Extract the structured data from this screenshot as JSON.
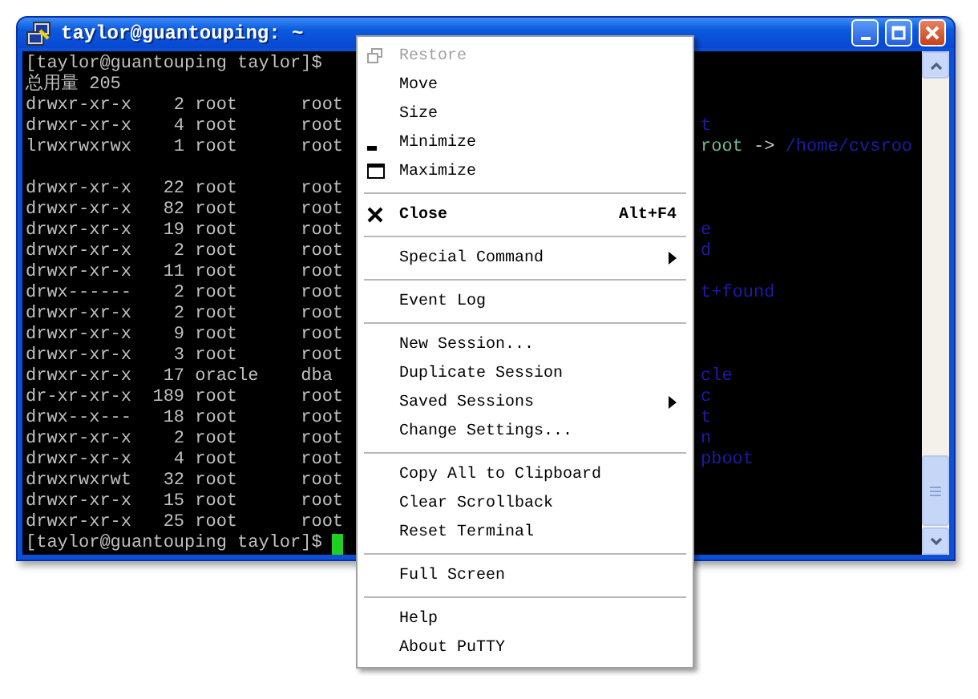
{
  "window": {
    "title": "taylor@guantouping: ~"
  },
  "terminal": {
    "lines": [
      {
        "kind": "text",
        "left": "[taylor@guantouping taylor]$"
      },
      {
        "kind": "text",
        "left": "总用量 205"
      },
      {
        "kind": "text",
        "left": "drwxr-xr-x    2 root      root"
      },
      {
        "kind": "text",
        "left": "drwxr-xr-x    4 root      root",
        "right": [
          {
            "text": "t",
            "color": "#1c1ca8"
          }
        ]
      },
      {
        "kind": "text",
        "left": "lrwxrwxrwx    1 root      root",
        "right": [
          {
            "text": "root",
            "color": "#70b890"
          },
          {
            "text": " -> ",
            "color": "#d0d0d0"
          },
          {
            "text": "/home/cvsroo",
            "color": "#1c1ca8"
          }
        ]
      },
      {
        "kind": "blank"
      },
      {
        "kind": "text",
        "left": "drwxr-xr-x   22 root      root"
      },
      {
        "kind": "text",
        "left": "drwxr-xr-x   82 root      root"
      },
      {
        "kind": "text",
        "left": "drwxr-xr-x   19 root      root",
        "right": [
          {
            "text": "e",
            "color": "#1c1ca8"
          }
        ]
      },
      {
        "kind": "text",
        "left": "drwxr-xr-x    2 root      root",
        "right": [
          {
            "text": "d",
            "color": "#1c1ca8"
          }
        ]
      },
      {
        "kind": "text",
        "left": "drwxr-xr-x   11 root      root"
      },
      {
        "kind": "text",
        "left": "drwx------    2 root      root",
        "right": [
          {
            "text": "t+found",
            "color": "#1c1ca8"
          }
        ]
      },
      {
        "kind": "text",
        "left": "drwxr-xr-x    2 root      root"
      },
      {
        "kind": "text",
        "left": "drwxr-xr-x    9 root      root"
      },
      {
        "kind": "text",
        "left": "drwxr-xr-x    3 root      root"
      },
      {
        "kind": "text",
        "left": "drwxr-xr-x   17 oracle    dba",
        "right": [
          {
            "text": "cle",
            "color": "#1c1ca8"
          }
        ]
      },
      {
        "kind": "text",
        "left": "dr-xr-xr-x  189 root      root",
        "right": [
          {
            "text": "c",
            "color": "#1c1ca8"
          }
        ]
      },
      {
        "kind": "text",
        "left": "drwx--x---   18 root      root",
        "right": [
          {
            "text": "t",
            "color": "#1c1ca8"
          }
        ]
      },
      {
        "kind": "text",
        "left": "drwxr-xr-x    2 root      root",
        "right": [
          {
            "text": "n",
            "color": "#1c1ca8"
          }
        ]
      },
      {
        "kind": "text",
        "left": "drwxr-xr-x    4 root      root",
        "right": [
          {
            "text": "pboot",
            "color": "#1c1ca8"
          }
        ]
      },
      {
        "kind": "text",
        "left": "drwxrwxrwt   32 root      root"
      },
      {
        "kind": "text",
        "left": "drwxr-xr-x   15 root      root"
      },
      {
        "kind": "text",
        "left": "drwxr-xr-x   25 root      root"
      },
      {
        "kind": "input",
        "left": "[taylor@guantouping taylor]$ "
      }
    ]
  },
  "menu": {
    "items": [
      {
        "kind": "restore",
        "label": "Restore",
        "disabled": true
      },
      {
        "kind": "plain",
        "label": "Move",
        "disabled": false
      },
      {
        "kind": "plain",
        "label": "Size",
        "disabled": false
      },
      {
        "kind": "minimize",
        "label": "Minimize",
        "disabled": false
      },
      {
        "kind": "maximize",
        "label": "Maximize",
        "disabled": false
      },
      {
        "kind": "separator"
      },
      {
        "kind": "close",
        "label": "Close",
        "shortcut": "Alt+F4",
        "disabled": false
      },
      {
        "kind": "separator"
      },
      {
        "kind": "submenu",
        "label": "Special Command",
        "disabled": false
      },
      {
        "kind": "separator"
      },
      {
        "kind": "plain",
        "label": "Event Log",
        "disabled": false
      },
      {
        "kind": "separator"
      },
      {
        "kind": "plain",
        "label": "New Session...",
        "disabled": false
      },
      {
        "kind": "plain",
        "label": "Duplicate Session",
        "disabled": false
      },
      {
        "kind": "submenu",
        "label": "Saved Sessions",
        "disabled": false
      },
      {
        "kind": "plain",
        "label": "Change Settings...",
        "disabled": false
      },
      {
        "kind": "separator"
      },
      {
        "kind": "plain",
        "label": "Copy All to Clipboard",
        "disabled": false
      },
      {
        "kind": "plain",
        "label": "Clear Scrollback",
        "disabled": false
      },
      {
        "kind": "plain",
        "label": "Reset Terminal",
        "disabled": false
      },
      {
        "kind": "separator"
      },
      {
        "kind": "plain",
        "label": "Full Screen",
        "disabled": false
      },
      {
        "kind": "separator"
      },
      {
        "kind": "plain",
        "label": "Help",
        "disabled": false
      },
      {
        "kind": "plain",
        "label": "About PuTTY",
        "disabled": false
      }
    ]
  }
}
